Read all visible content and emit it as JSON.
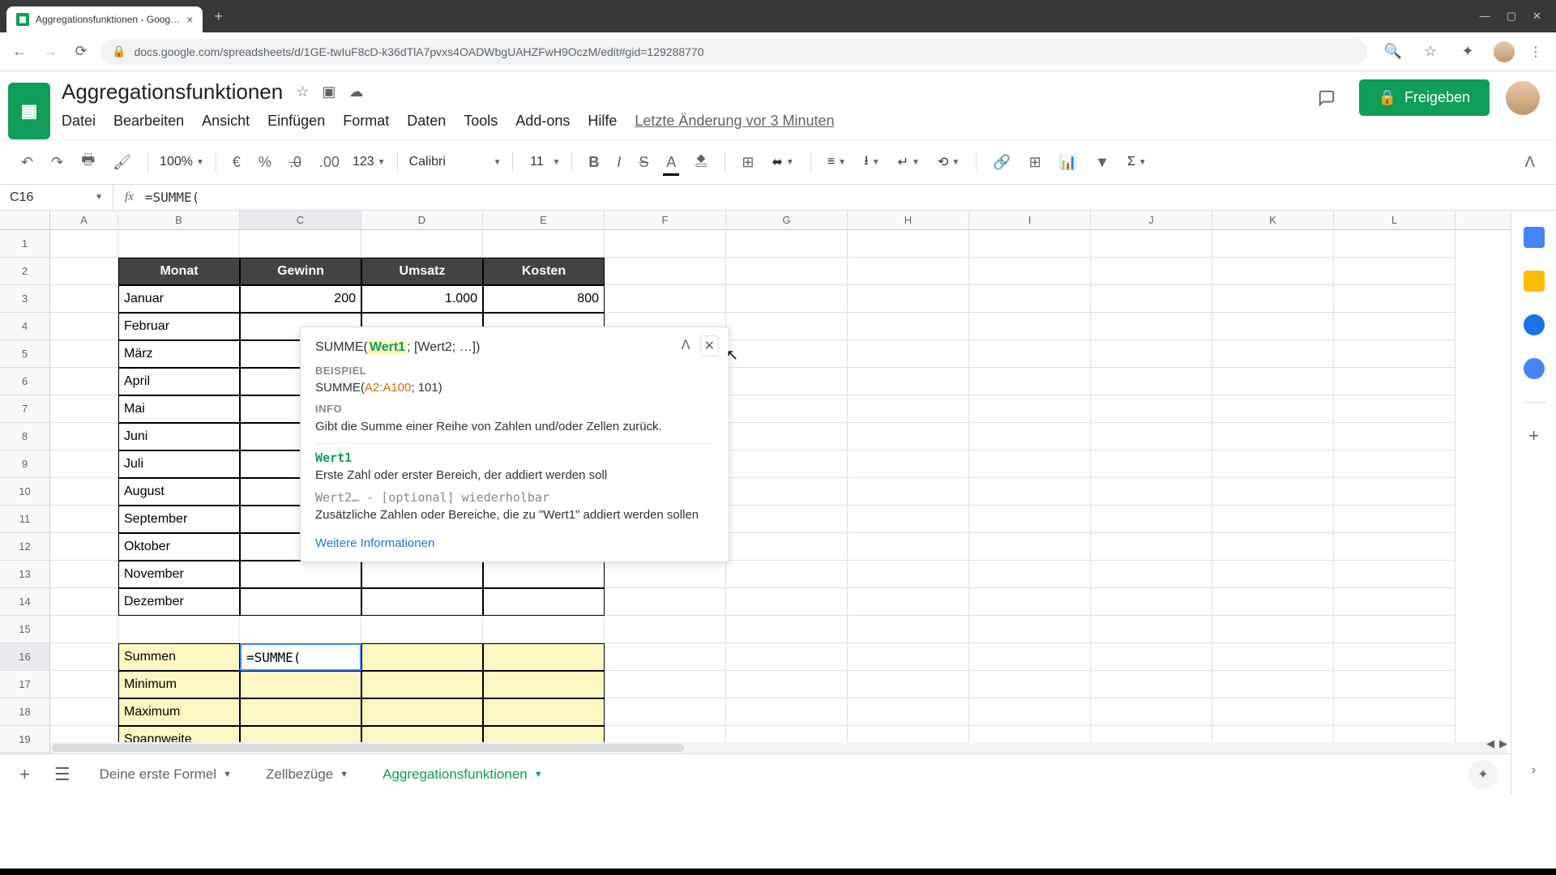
{
  "browser": {
    "tab_title": "Aggregationsfunktionen - Goog…",
    "url": "docs.google.com/spreadsheets/d/1GE-twIuF8cD-k36dTlA7pvxs4OADWbgUAHZFwH9OczM/edit#gid=129288770"
  },
  "doc": {
    "title": "Aggregationsfunktionen",
    "menu": [
      "Datei",
      "Bearbeiten",
      "Ansicht",
      "Einfügen",
      "Format",
      "Daten",
      "Tools",
      "Add-ons",
      "Hilfe"
    ],
    "last_edit": "Letzte Änderung vor 3 Minuten",
    "share": "Freigeben"
  },
  "toolbar": {
    "zoom": "100%",
    "currency": "€",
    "percent": "%",
    "dec_dec": ".0",
    "dec_inc": ".00",
    "num_fmt": "123",
    "font": "Calibri",
    "size": "11"
  },
  "namebox": "C16",
  "formula": "=SUMME(",
  "columns": [
    "A",
    "B",
    "C",
    "D",
    "E",
    "F",
    "G",
    "H",
    "I",
    "J",
    "K",
    "L"
  ],
  "rows": [
    "1",
    "2",
    "3",
    "4",
    "5",
    "6",
    "7",
    "8",
    "9",
    "10",
    "11",
    "12",
    "13",
    "14",
    "15",
    "16",
    "17",
    "18",
    "19"
  ],
  "table": {
    "headers": [
      "Monat",
      "Gewinn",
      "Umsatz",
      "Kosten"
    ],
    "months": [
      "Januar",
      "Februar",
      "März",
      "April",
      "Mai",
      "Juni",
      "Juli",
      "August",
      "September",
      "Oktober",
      "November",
      "Dezember"
    ],
    "row3": {
      "gewinn": "200",
      "umsatz": "1.000",
      "kosten": "800"
    },
    "summary": [
      "Summen",
      "Minimum",
      "Maximum",
      "Spannweite"
    ],
    "editing": "=SUMME("
  },
  "tooltip": {
    "sig_pre": "SUMME(",
    "sig_hl": "Wert1",
    "sig_post": "; [Wert2; …])",
    "beispiel_label": "BEISPIEL",
    "beispiel_pre": "SUMME(",
    "beispiel_ref": "A2:A100",
    "beispiel_post": "; 101)",
    "info_label": "INFO",
    "info_text": "Gibt die Summe einer Reihe von Zahlen und/oder Zellen zurück.",
    "arg1_name": "Wert1",
    "arg1_desc": "Erste Zahl oder erster Bereich, der addiert werden soll",
    "arg2_sig": "Wert2… - [optional] wiederholbar",
    "arg2_desc": "Zusätzliche Zahlen oder Bereiche, die zu \"Wert1\" addiert werden sollen",
    "link": "Weitere Informationen"
  },
  "sheets": {
    "add": "+",
    "list": [
      "Deine erste Formel",
      "Zellbezüge",
      "Aggregationsfunktionen"
    ],
    "active": 2
  }
}
